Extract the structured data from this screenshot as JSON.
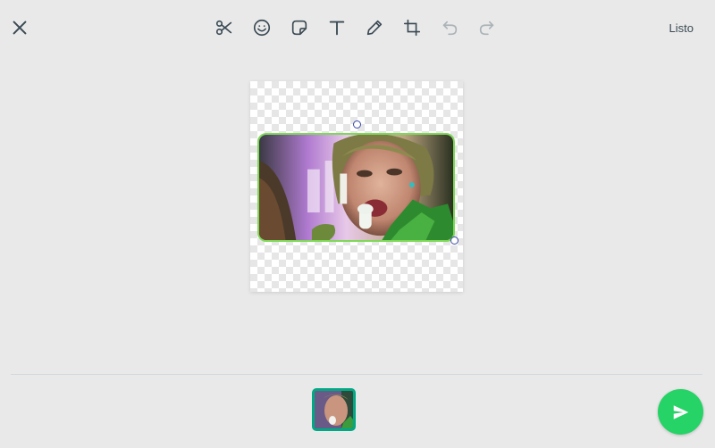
{
  "header": {
    "close_icon": "close-icon",
    "done_label": "Listo"
  },
  "toolbar": {
    "tools": [
      "scissors-icon",
      "emoji-icon",
      "sticker-icon",
      "text-icon",
      "pencil-icon",
      "crop-rotate-icon",
      "undo-icon",
      "redo-icon"
    ]
  },
  "colors": {
    "background": "#e9e9e9",
    "selection_border": "#7ed957",
    "thumb_border": "#00a884",
    "send_button": "#25d366",
    "icon": "#3b4a54",
    "icon_disabled": "#aab3b8"
  },
  "footer": {
    "send_icon": "send-icon"
  }
}
